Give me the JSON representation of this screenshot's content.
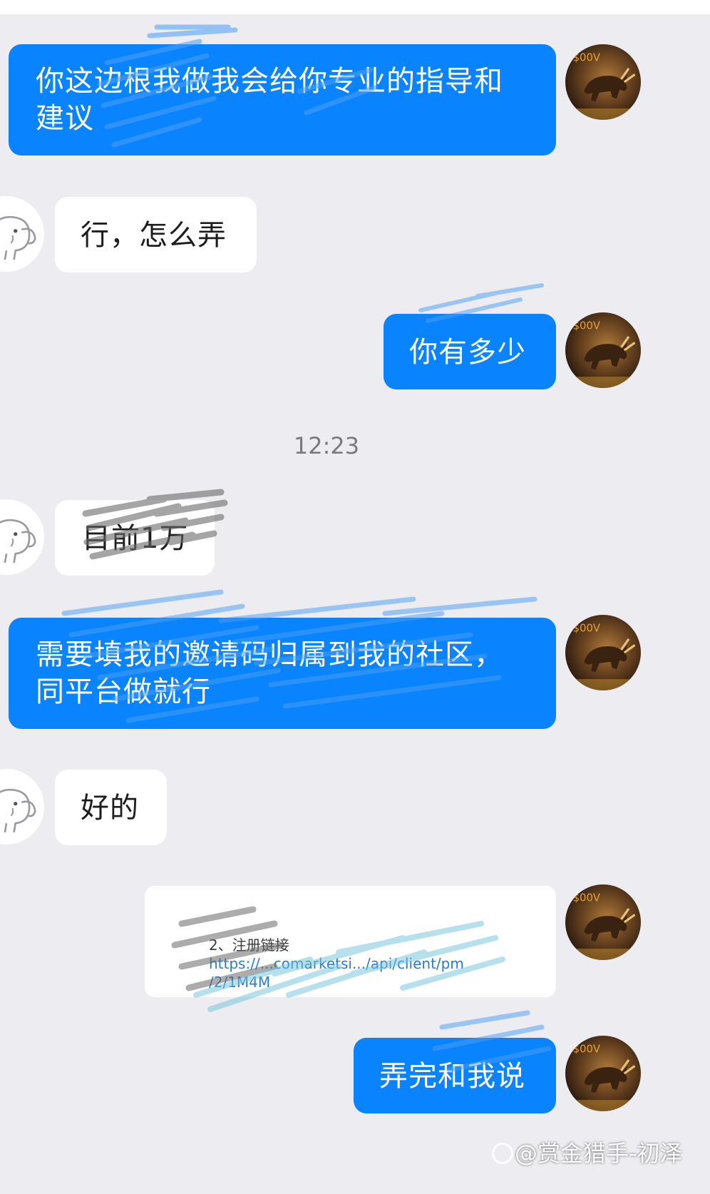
{
  "messages": [
    {
      "side": "out",
      "text": "你这边根我做我会给你专业的指导和建议"
    },
    {
      "side": "in",
      "text": "行，怎么弄"
    },
    {
      "side": "out",
      "text": "你有多少"
    },
    {
      "side": "in",
      "text": "目前1万"
    },
    {
      "side": "out",
      "text": "需要填我的邀请码归属到我的社区，同平台做就行"
    },
    {
      "side": "in",
      "text": "好的"
    },
    {
      "side": "out",
      "text": "弄完和我说"
    }
  ],
  "timestamp": "12:23",
  "link_card": {
    "title": "2、注册链接",
    "url_line1": "https://...comarketsi.../api/client/pm",
    "url_line2": "/2/1M4M"
  },
  "watermark": "@赏金猎手-初泽",
  "colors": {
    "background": "#ededf1",
    "outgoing_bubble": "#0a84fe",
    "incoming_bubble": "#ffffff",
    "scribble_blue": "#4a9ef5",
    "scribble_gray": "#6a6a6a",
    "scribble_cyan": "#6fc3da"
  },
  "icons": {
    "own_avatar": "bull-avatar-icon",
    "peer_avatar": "elephant-avatar-icon"
  }
}
